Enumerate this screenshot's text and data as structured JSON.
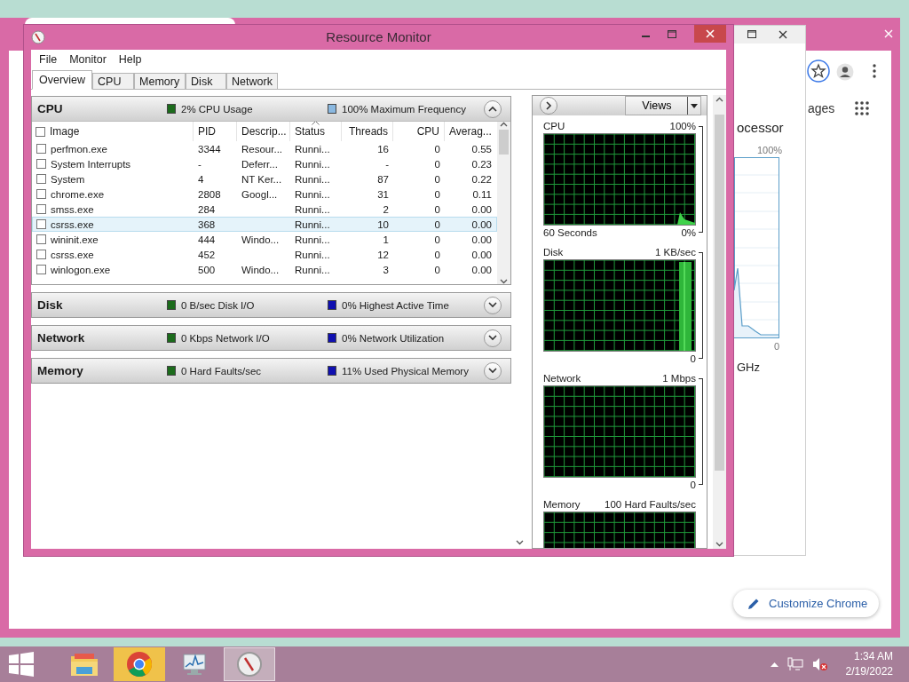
{
  "chrome_window": {
    "side_link": "ages",
    "customize_button": "Customize Chrome"
  },
  "task_manager_window": {
    "heading": "ocessor",
    "max_label": "100%",
    "min_label": "0",
    "unit": "GHz"
  },
  "resource_monitor": {
    "title": "Resource Monitor",
    "menu": [
      "File",
      "Monitor",
      "Help"
    ],
    "tabs": [
      {
        "label": "Overview",
        "selected": true
      },
      {
        "label": "CPU",
        "selected": false
      },
      {
        "label": "Memory",
        "selected": false
      },
      {
        "label": "Disk",
        "selected": false
      },
      {
        "label": "Network",
        "selected": false
      }
    ],
    "cpu_section": {
      "title": "CPU",
      "expanded": true,
      "all_checked": false,
      "stats": [
        {
          "text": "2% CPU Usage",
          "color": "#1c6b1c"
        },
        {
          "text": "100% Maximum Frequency",
          "color": "#8ab8e0"
        }
      ],
      "columns": [
        {
          "label": "Image",
          "sorted": false
        },
        {
          "label": "PID",
          "sorted": false
        },
        {
          "label": "Descrip...",
          "sorted": false
        },
        {
          "label": "Status",
          "sorted": true
        },
        {
          "label": "Threads",
          "sorted": false
        },
        {
          "label": "CPU",
          "sorted": false
        },
        {
          "label": "Averag...",
          "sorted": false
        }
      ],
      "rows": [
        {
          "image": "perfmon.exe",
          "pid": "3344",
          "description": "Resour...",
          "status": "Runni...",
          "threads": "16",
          "cpu": "0",
          "average": "0.55",
          "checked": false,
          "selected": false
        },
        {
          "image": "System Interrupts",
          "pid": "-",
          "description": "Deferr...",
          "status": "Runni...",
          "threads": "-",
          "cpu": "0",
          "average": "0.23",
          "checked": false,
          "selected": false
        },
        {
          "image": "System",
          "pid": "4",
          "description": "NT Ker...",
          "status": "Runni...",
          "threads": "87",
          "cpu": "0",
          "average": "0.22",
          "checked": false,
          "selected": false
        },
        {
          "image": "chrome.exe",
          "pid": "2808",
          "description": "Googl...",
          "status": "Runni...",
          "threads": "31",
          "cpu": "0",
          "average": "0.11",
          "checked": false,
          "selected": false
        },
        {
          "image": "smss.exe",
          "pid": "284",
          "status": "Runni...",
          "threads": "2",
          "cpu": "0",
          "average": "0.00",
          "checked": false,
          "selected": false
        },
        {
          "image": "csrss.exe",
          "pid": "368",
          "status": "Runni...",
          "threads": "10",
          "cpu": "0",
          "average": "0.00",
          "checked": false,
          "selected": true
        },
        {
          "image": "wininit.exe",
          "pid": "444",
          "description": "Windo...",
          "status": "Runni...",
          "threads": "1",
          "cpu": "0",
          "average": "0.00",
          "checked": false,
          "selected": false
        },
        {
          "image": "csrss.exe",
          "pid": "452",
          "status": "Runni...",
          "threads": "12",
          "cpu": "0",
          "average": "0.00",
          "checked": false,
          "selected": false
        },
        {
          "image": "winlogon.exe",
          "pid": "500",
          "description": "Windo...",
          "status": "Runni...",
          "threads": "3",
          "cpu": "0",
          "average": "0.00",
          "checked": false,
          "selected": false
        }
      ]
    },
    "sections": [
      {
        "title": "Disk",
        "expanded": false,
        "stats": [
          {
            "text": "0 B/sec Disk I/O",
            "color": "#1c6b1c"
          },
          {
            "text": "0% Highest Active Time",
            "color": "#1010b0"
          }
        ]
      },
      {
        "title": "Network",
        "expanded": false,
        "stats": [
          {
            "text": "0 Kbps Network I/O",
            "color": "#1c6b1c"
          },
          {
            "text": "0% Network Utilization",
            "color": "#1010b0"
          }
        ]
      },
      {
        "title": "Memory",
        "expanded": false,
        "stats": [
          {
            "text": "0 Hard Faults/sec",
            "color": "#1c6b1c"
          },
          {
            "text": "11% Used Physical Memory",
            "color": "#1010b0"
          }
        ]
      }
    ],
    "graph_panel": {
      "views_button": "Views",
      "graphs": [
        {
          "kind": "cpu",
          "title": "CPU",
          "max": "100%",
          "time": "60 Seconds",
          "min": "0%"
        },
        {
          "kind": "disk",
          "title": "Disk",
          "max": "1 KB/sec",
          "min": "0"
        },
        {
          "kind": "network",
          "title": "Network",
          "max": "1 Mbps",
          "min": "0"
        },
        {
          "kind": "memory",
          "title": "Memory",
          "max": "100 Hard Faults/sec"
        }
      ]
    }
  },
  "taskbar": {
    "apps": [
      {
        "kind": "explorer",
        "selected": false,
        "flashing": false
      },
      {
        "kind": "chrome",
        "selected": false,
        "flashing": true
      },
      {
        "kind": "perfmon",
        "selected": false,
        "flashing": false
      },
      {
        "kind": "resmon",
        "selected": true,
        "flashing": false
      }
    ],
    "time": "1:34 AM",
    "date": "2/19/2022"
  }
}
